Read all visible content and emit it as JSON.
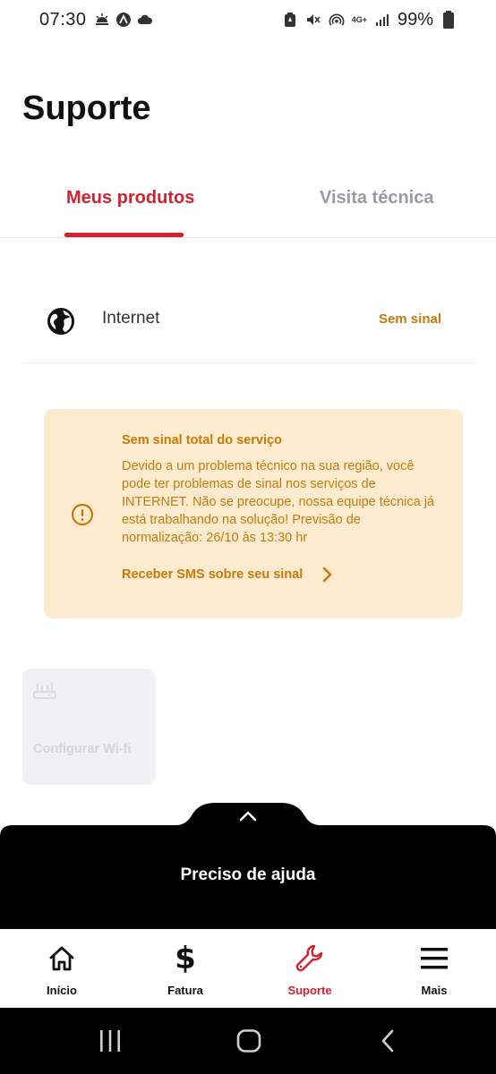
{
  "status_bar": {
    "time": "07:30",
    "network_label": "4G+",
    "battery": "99%"
  },
  "page": {
    "title": "Suporte"
  },
  "tabs": [
    {
      "label": "Meus produtos",
      "active": true
    },
    {
      "label": "Visita técnica",
      "active": false
    }
  ],
  "product": {
    "name": "Internet",
    "status": "Sem sinal"
  },
  "alert": {
    "title": "Sem sinal total do serviço",
    "body": "Devido a um problema técnico na sua região, você pode ter problemas de sinal nos serviços de INTERNET. Não se preocupe, nossa equipe técnica já está trabalhando na solução! Previsão de normalização: 26/10 às 13:30 hr",
    "link_label": "Receber SMS sobre seu sinal",
    "color": "#c77a08",
    "background": "#fdebd0"
  },
  "config_card": {
    "label": "Configurar Wi-fi"
  },
  "help_sheet": {
    "label": "Preciso de ajuda"
  },
  "bottom_nav": [
    {
      "label": "Início",
      "icon": "home-icon",
      "active": false
    },
    {
      "label": "Fatura",
      "icon": "dollar-icon",
      "active": false
    },
    {
      "label": "Suporte",
      "icon": "wrench-icon",
      "active": true
    },
    {
      "label": "Mais",
      "icon": "menu-icon",
      "active": false
    }
  ],
  "colors": {
    "accent": "#d5202e",
    "warning": "#c77a08",
    "inactive_tab": "#9a9aa2"
  }
}
